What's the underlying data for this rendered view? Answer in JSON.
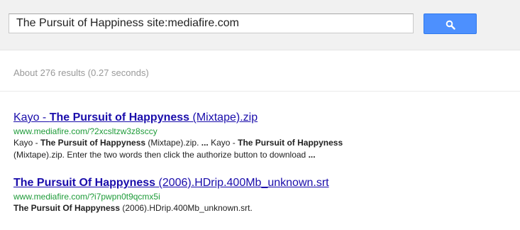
{
  "search": {
    "query": "The Pursuit of Happiness site:mediafire.com",
    "button_icon": "search-icon"
  },
  "stats": {
    "text": "About 276 results (0.27 seconds)"
  },
  "results": [
    {
      "title_prefix": "Kayo - ",
      "title_bold": "The Pursuit of Happyness",
      "title_suffix": " (Mixtape).zip",
      "url": "www.mediafire.com/?2xcsltzw3z8sccy",
      "snippet": {
        "p1": "Kayo - ",
        "b1": "The Pursuit of Happyness",
        "p2": " (Mixtape).zip. ",
        "b2": "...",
        "p3": " Kayo - ",
        "b3": "The Pursuit of Happyness",
        "p4": " (Mixtape).zip. Enter the two words then click the authorize button to download ",
        "b4": "..."
      }
    },
    {
      "title_bold": "The Pursuit Of Happyness",
      "title_suffix": " (2006).HDrip.400Mb_unknown.srt",
      "url": "www.mediafire.com/?i7pwpn0t9qcmx5i",
      "snippet": {
        "b1": "The Pursuit Of Happyness",
        "p1": " (2006).HDrip.400Mb_unknown.srt."
      }
    }
  ],
  "colors": {
    "link": "#1a0dab",
    "url": "#1e9b39",
    "stats": "#999999",
    "button": "#4d90fe",
    "topbar": "#f1f1f1"
  }
}
